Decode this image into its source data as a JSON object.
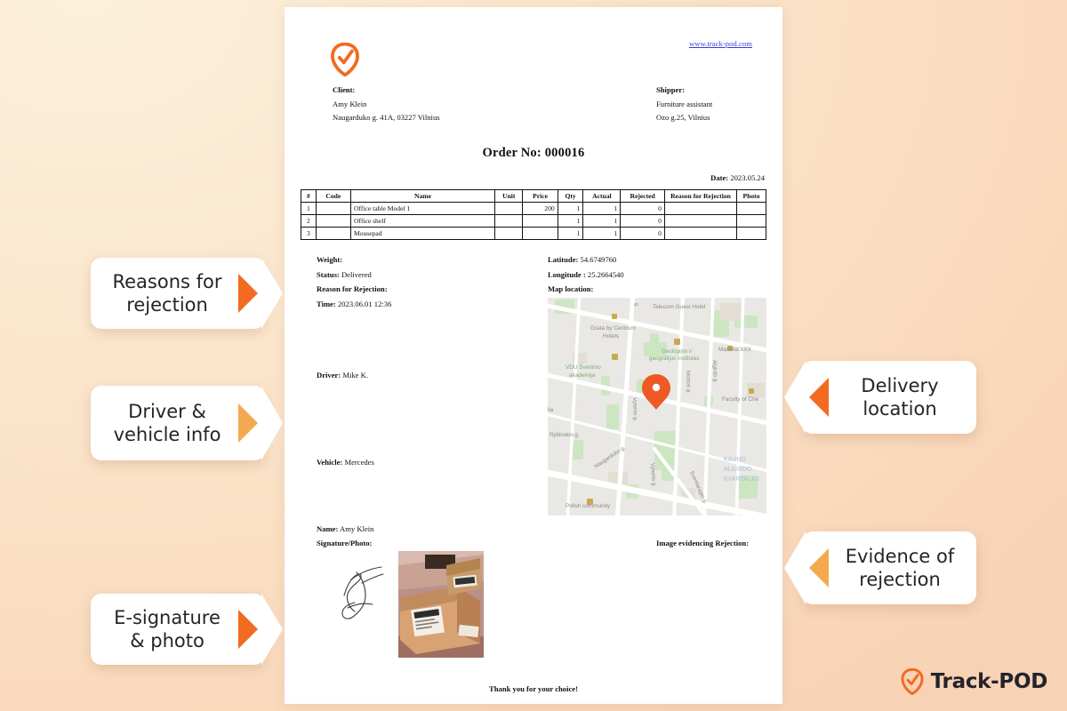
{
  "brand": {
    "accent_orange": "#F26B21",
    "accent_orange_light": "#F5A94E",
    "logo_icon": "shield-check-pin-icon",
    "footer_wordmark": "Track-POD"
  },
  "background": {
    "top_left_color": "#FCF0DB",
    "bottom_right_color": "#F8D2B5"
  },
  "document": {
    "site_url": "www.track-pod.com",
    "client": {
      "title": "Client:",
      "name": "Amy Klein",
      "address": "Naugarduko g. 41A, 03227 Vilnius"
    },
    "shipper": {
      "title": "Shipper:",
      "name": "Furniture assistant",
      "address": "Ozo g.25, Vilnius"
    },
    "order_title": "Order No: 000016",
    "date_label": "Date:",
    "date_value": "2023.05.24",
    "table": {
      "headers": [
        "#",
        "Code",
        "Name",
        "Unit",
        "Price",
        "Qty",
        "Actual",
        "Rejected",
        "Reason for Rejection",
        "Photo"
      ],
      "rows": [
        {
          "no": "1",
          "code": "",
          "name": "Office table Model 1",
          "unit": "",
          "price": "200",
          "qty": "1",
          "actual": "1",
          "rejected": "0",
          "reason": "",
          "photo": ""
        },
        {
          "no": "2",
          "code": "",
          "name": "Office shelf",
          "unit": "",
          "price": "",
          "qty": "1",
          "actual": "1",
          "rejected": "0",
          "reason": "",
          "photo": ""
        },
        {
          "no": "3",
          "code": "",
          "name": "Mousepad",
          "unit": "",
          "price": "",
          "qty": "1",
          "actual": "1",
          "rejected": "0",
          "reason": "",
          "photo": ""
        }
      ]
    },
    "details_left": {
      "weight_label": "Weight:",
      "weight_value": "",
      "status_label": "Status:",
      "status_value": "Delivered",
      "reason_label": "Reason for Rejection:",
      "reason_value": "",
      "time_label": "Time:",
      "time_value": "2023.06.01 12:36"
    },
    "details_right": {
      "latitude_label": "Latitude:",
      "latitude_value": "54.6749760",
      "longitude_label": "Longitude :",
      "longitude_value": "25.2664540",
      "map_label": "Map location:"
    },
    "driver_label": "Driver:",
    "driver_value": "Mike K.",
    "vehicle_label": "Vehicle:",
    "vehicle_value": "Mercedes",
    "signature": {
      "name_label": "Name:",
      "name_value": "Amy Klein",
      "signature_label": "Signature/Photo:",
      "evidence_label": "Image evidencing Rejection:"
    },
    "thanks": "Thank you for your choice!",
    "map": {
      "marker": "map-pin-marker",
      "labels": [
        "Telecom Guest Hotel",
        "Grata by Centrum Hotels",
        "Geologijos ir geografijos institutas",
        "Maxima XXX",
        "VDU Švietimo akademija",
        "Faculty of Che",
        "Naugarduko g.",
        "Vytenio g.",
        "Mortos g.",
        "Algirdo g.",
        "Rybinskio g.",
        "Vytenio g.",
        "Sventaragio g.",
        "KAUNO ALGIRDO KVARTALAS",
        "Polish community"
      ]
    }
  },
  "callouts": [
    {
      "id": "reasons-for-rejection",
      "line1": "Reasons for",
      "line2": "rejection",
      "side": "left",
      "arrow_color": "#F26B21"
    },
    {
      "id": "driver-vehicle-info",
      "line1": "Driver &",
      "line2": "vehicle info",
      "side": "left",
      "arrow_color": "#F5A94E"
    },
    {
      "id": "e-signature-photo",
      "line1": "E-signature",
      "line2": "& photo",
      "side": "left",
      "arrow_color": "#F26B21"
    },
    {
      "id": "delivery-location",
      "line1": "Delivery",
      "line2": "location",
      "side": "right",
      "arrow_color": "#F26B21"
    },
    {
      "id": "evidence-of-rejection",
      "line1": "Evidence of",
      "line2": "rejection",
      "side": "right",
      "arrow_color": "#F5A94E"
    }
  ]
}
